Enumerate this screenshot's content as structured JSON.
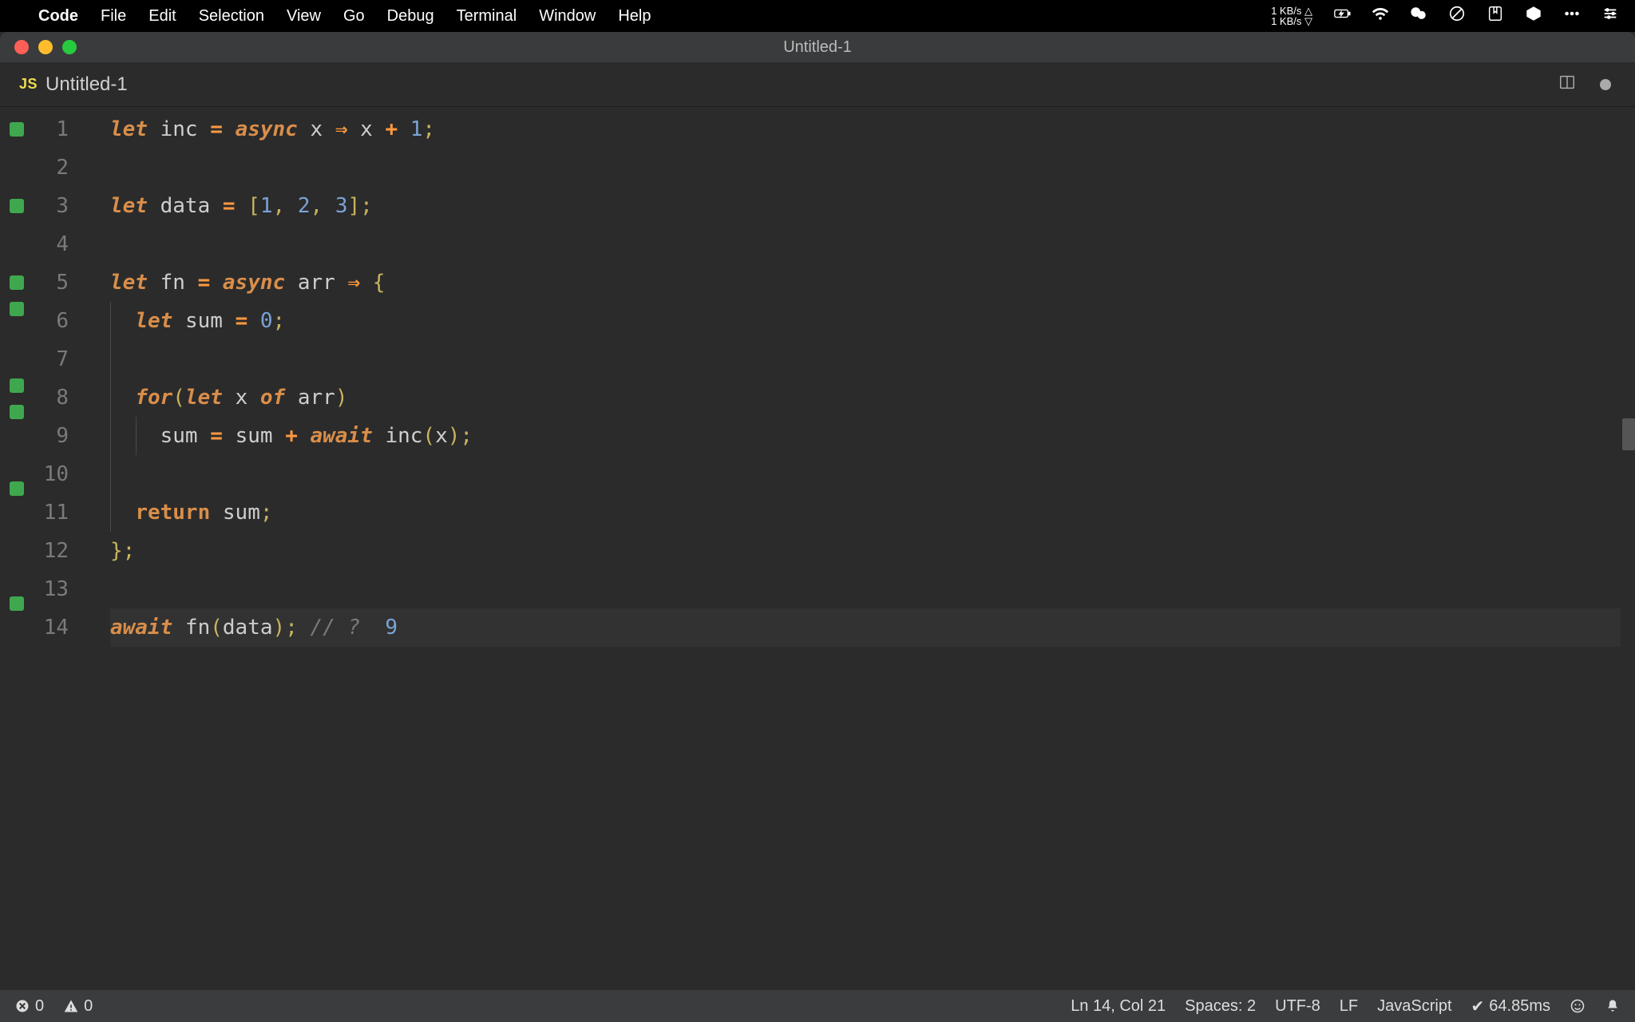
{
  "menubar": {
    "appname": "Code",
    "items": [
      "File",
      "Edit",
      "Selection",
      "View",
      "Go",
      "Debug",
      "Terminal",
      "Window",
      "Help"
    ],
    "net_up": "1 KB/s △",
    "net_down": "1 KB/s ▽"
  },
  "window": {
    "title": "Untitled-1"
  },
  "tab": {
    "badge": "JS",
    "label": "Untitled-1"
  },
  "code_lines": [
    {
      "n": 1,
      "mark": true,
      "indent": 0,
      "tokens": [
        [
          "keyword",
          "let"
        ],
        [
          "sp",
          " "
        ],
        [
          "ident",
          "inc"
        ],
        [
          "sp",
          " "
        ],
        [
          "op",
          "="
        ],
        [
          "sp",
          " "
        ],
        [
          "keyword",
          "async"
        ],
        [
          "sp",
          " "
        ],
        [
          "ident",
          "x"
        ],
        [
          "sp",
          " "
        ],
        [
          "arrow",
          "⇒"
        ],
        [
          "sp",
          " "
        ],
        [
          "ident",
          "x"
        ],
        [
          "sp",
          " "
        ],
        [
          "op",
          "+"
        ],
        [
          "sp",
          " "
        ],
        [
          "num",
          "1"
        ],
        [
          "punct",
          ";"
        ]
      ]
    },
    {
      "n": 2,
      "mark": false,
      "indent": 0,
      "tokens": []
    },
    {
      "n": 3,
      "mark": true,
      "indent": 0,
      "tokens": [
        [
          "keyword",
          "let"
        ],
        [
          "sp",
          " "
        ],
        [
          "ident",
          "data"
        ],
        [
          "sp",
          " "
        ],
        [
          "op",
          "="
        ],
        [
          "sp",
          " "
        ],
        [
          "punct",
          "["
        ],
        [
          "num",
          "1"
        ],
        [
          "punct",
          ","
        ],
        [
          "sp",
          " "
        ],
        [
          "num",
          "2"
        ],
        [
          "punct",
          ","
        ],
        [
          "sp",
          " "
        ],
        [
          "num",
          "3"
        ],
        [
          "punct",
          "]"
        ],
        [
          "punct",
          ";"
        ]
      ]
    },
    {
      "n": 4,
      "mark": false,
      "indent": 0,
      "tokens": []
    },
    {
      "n": 5,
      "mark": true,
      "indent": 0,
      "tokens": [
        [
          "keyword",
          "let"
        ],
        [
          "sp",
          " "
        ],
        [
          "ident",
          "fn"
        ],
        [
          "sp",
          " "
        ],
        [
          "op",
          "="
        ],
        [
          "sp",
          " "
        ],
        [
          "keyword",
          "async"
        ],
        [
          "sp",
          " "
        ],
        [
          "ident",
          "arr"
        ],
        [
          "sp",
          " "
        ],
        [
          "arrow",
          "⇒"
        ],
        [
          "sp",
          " "
        ],
        [
          "punct",
          "{"
        ]
      ]
    },
    {
      "n": 6,
      "mark": true,
      "indent": 1,
      "tokens": [
        [
          "sp",
          "  "
        ],
        [
          "keyword",
          "let"
        ],
        [
          "sp",
          " "
        ],
        [
          "ident",
          "sum"
        ],
        [
          "sp",
          " "
        ],
        [
          "op",
          "="
        ],
        [
          "sp",
          " "
        ],
        [
          "num",
          "0"
        ],
        [
          "punct",
          ";"
        ]
      ]
    },
    {
      "n": 7,
      "mark": false,
      "indent": 1,
      "tokens": []
    },
    {
      "n": 8,
      "mark": true,
      "indent": 1,
      "tokens": [
        [
          "sp",
          "  "
        ],
        [
          "keyword",
          "for"
        ],
        [
          "punct",
          "("
        ],
        [
          "keyword",
          "let"
        ],
        [
          "sp",
          " "
        ],
        [
          "ident",
          "x"
        ],
        [
          "sp",
          " "
        ],
        [
          "keyword",
          "of"
        ],
        [
          "sp",
          " "
        ],
        [
          "ident",
          "arr"
        ],
        [
          "punct",
          ")"
        ]
      ]
    },
    {
      "n": 9,
      "mark": true,
      "indent": 2,
      "tokens": [
        [
          "sp",
          "    "
        ],
        [
          "ident",
          "sum"
        ],
        [
          "sp",
          " "
        ],
        [
          "op",
          "="
        ],
        [
          "sp",
          " "
        ],
        [
          "ident",
          "sum"
        ],
        [
          "sp",
          " "
        ],
        [
          "op",
          "+"
        ],
        [
          "sp",
          " "
        ],
        [
          "keyword",
          "await"
        ],
        [
          "sp",
          " "
        ],
        [
          "func",
          "inc"
        ],
        [
          "punct",
          "("
        ],
        [
          "ident",
          "x"
        ],
        [
          "punct",
          ")"
        ],
        [
          "punct",
          ";"
        ]
      ]
    },
    {
      "n": 10,
      "mark": false,
      "indent": 1,
      "tokens": []
    },
    {
      "n": 11,
      "mark": true,
      "indent": 1,
      "tokens": [
        [
          "sp",
          "  "
        ],
        [
          "keyword-ni",
          "return"
        ],
        [
          "sp",
          " "
        ],
        [
          "ident",
          "sum"
        ],
        [
          "punct",
          ";"
        ]
      ]
    },
    {
      "n": 12,
      "mark": false,
      "indent": 0,
      "tokens": [
        [
          "punct",
          "}"
        ],
        [
          "punct",
          ";"
        ]
      ]
    },
    {
      "n": 13,
      "mark": false,
      "indent": 0,
      "tokens": []
    },
    {
      "n": 14,
      "mark": true,
      "indent": 0,
      "current": true,
      "tokens": [
        [
          "keyword",
          "await"
        ],
        [
          "sp",
          " "
        ],
        [
          "func",
          "fn"
        ],
        [
          "punct",
          "("
        ],
        [
          "ident",
          "data"
        ],
        [
          "punct",
          ")"
        ],
        [
          "punct",
          ";"
        ],
        [
          "sp",
          " "
        ],
        [
          "comment",
          "// ?  "
        ],
        [
          "result",
          "9"
        ]
      ]
    }
  ],
  "statusbar": {
    "errors": "0",
    "warnings": "0",
    "cursor": "Ln 14, Col 21",
    "spaces": "Spaces: 2",
    "encoding": "UTF-8",
    "eol": "LF",
    "language": "JavaScript",
    "timing_prefix": "✔",
    "timing": "64.85ms"
  }
}
